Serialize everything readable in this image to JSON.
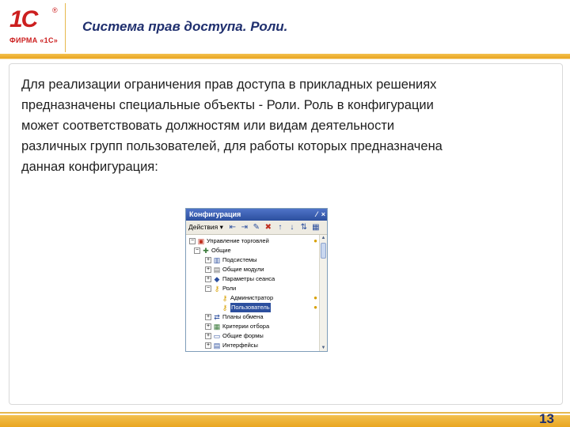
{
  "logo": {
    "brand": "1С",
    "registered": "®",
    "caption": "ФИРМА «1С»"
  },
  "header": {
    "title": "Система прав доступа. Роли."
  },
  "body": {
    "text_lines": [
      "Для реализации ограничения прав доступа в прикладных решениях",
      "предназначены специальные объекты - Роли. Роль в конфигурации",
      "может соответствовать должностям или видам деятельности",
      "различных групп пользователей, для работы которых предназначена",
      "данная конфигурация:"
    ]
  },
  "config_window": {
    "title": "Конфигурация",
    "pin_icon": "pin-icon",
    "close_glyph": "×",
    "toolbar": {
      "actions_label": "Действия ▾",
      "icons": [
        "move-left-icon",
        "move-right-icon",
        "edit-icon",
        "delete-icon",
        "move-up-icon",
        "move-down-icon",
        "sort-icon",
        "filter-icon"
      ]
    },
    "tree": [
      {
        "label": "Управление торговлей",
        "level": 0,
        "expander": "−",
        "icon": "config-root-icon"
      },
      {
        "label": "Общие",
        "level": 1,
        "expander": "−",
        "icon": "common-icon"
      },
      {
        "label": "Подсистемы",
        "level": 2,
        "expander": "+",
        "icon": "subsystems-icon"
      },
      {
        "label": "Общие модули",
        "level": 2,
        "expander": "+",
        "icon": "modules-icon"
      },
      {
        "label": "Параметры сеанса",
        "level": 2,
        "expander": "+",
        "icon": "session-params-icon"
      },
      {
        "label": "Роли",
        "level": 2,
        "expander": "−",
        "icon": "roles-icon"
      },
      {
        "label": "Администратор",
        "level": 3,
        "expander": "",
        "icon": "key-icon"
      },
      {
        "label": "Пользователь",
        "level": 3,
        "expander": "",
        "icon": "key-icon",
        "selected": true
      },
      {
        "label": "Планы обмена",
        "level": 2,
        "expander": "+",
        "icon": "exchange-plans-icon"
      },
      {
        "label": "Критерии отбора",
        "level": 2,
        "expander": "+",
        "icon": "criteria-icon"
      },
      {
        "label": "Общие формы",
        "level": 2,
        "expander": "+",
        "icon": "forms-icon"
      },
      {
        "label": "Интерфейсы",
        "level": 2,
        "expander": "+",
        "icon": "interfaces-icon"
      }
    ]
  },
  "page_number": "13",
  "colors": {
    "title": "#1f2f6e",
    "accent": "#e9a520",
    "logo_red": "#cc1f1f",
    "selection": "#2c4f9e"
  }
}
